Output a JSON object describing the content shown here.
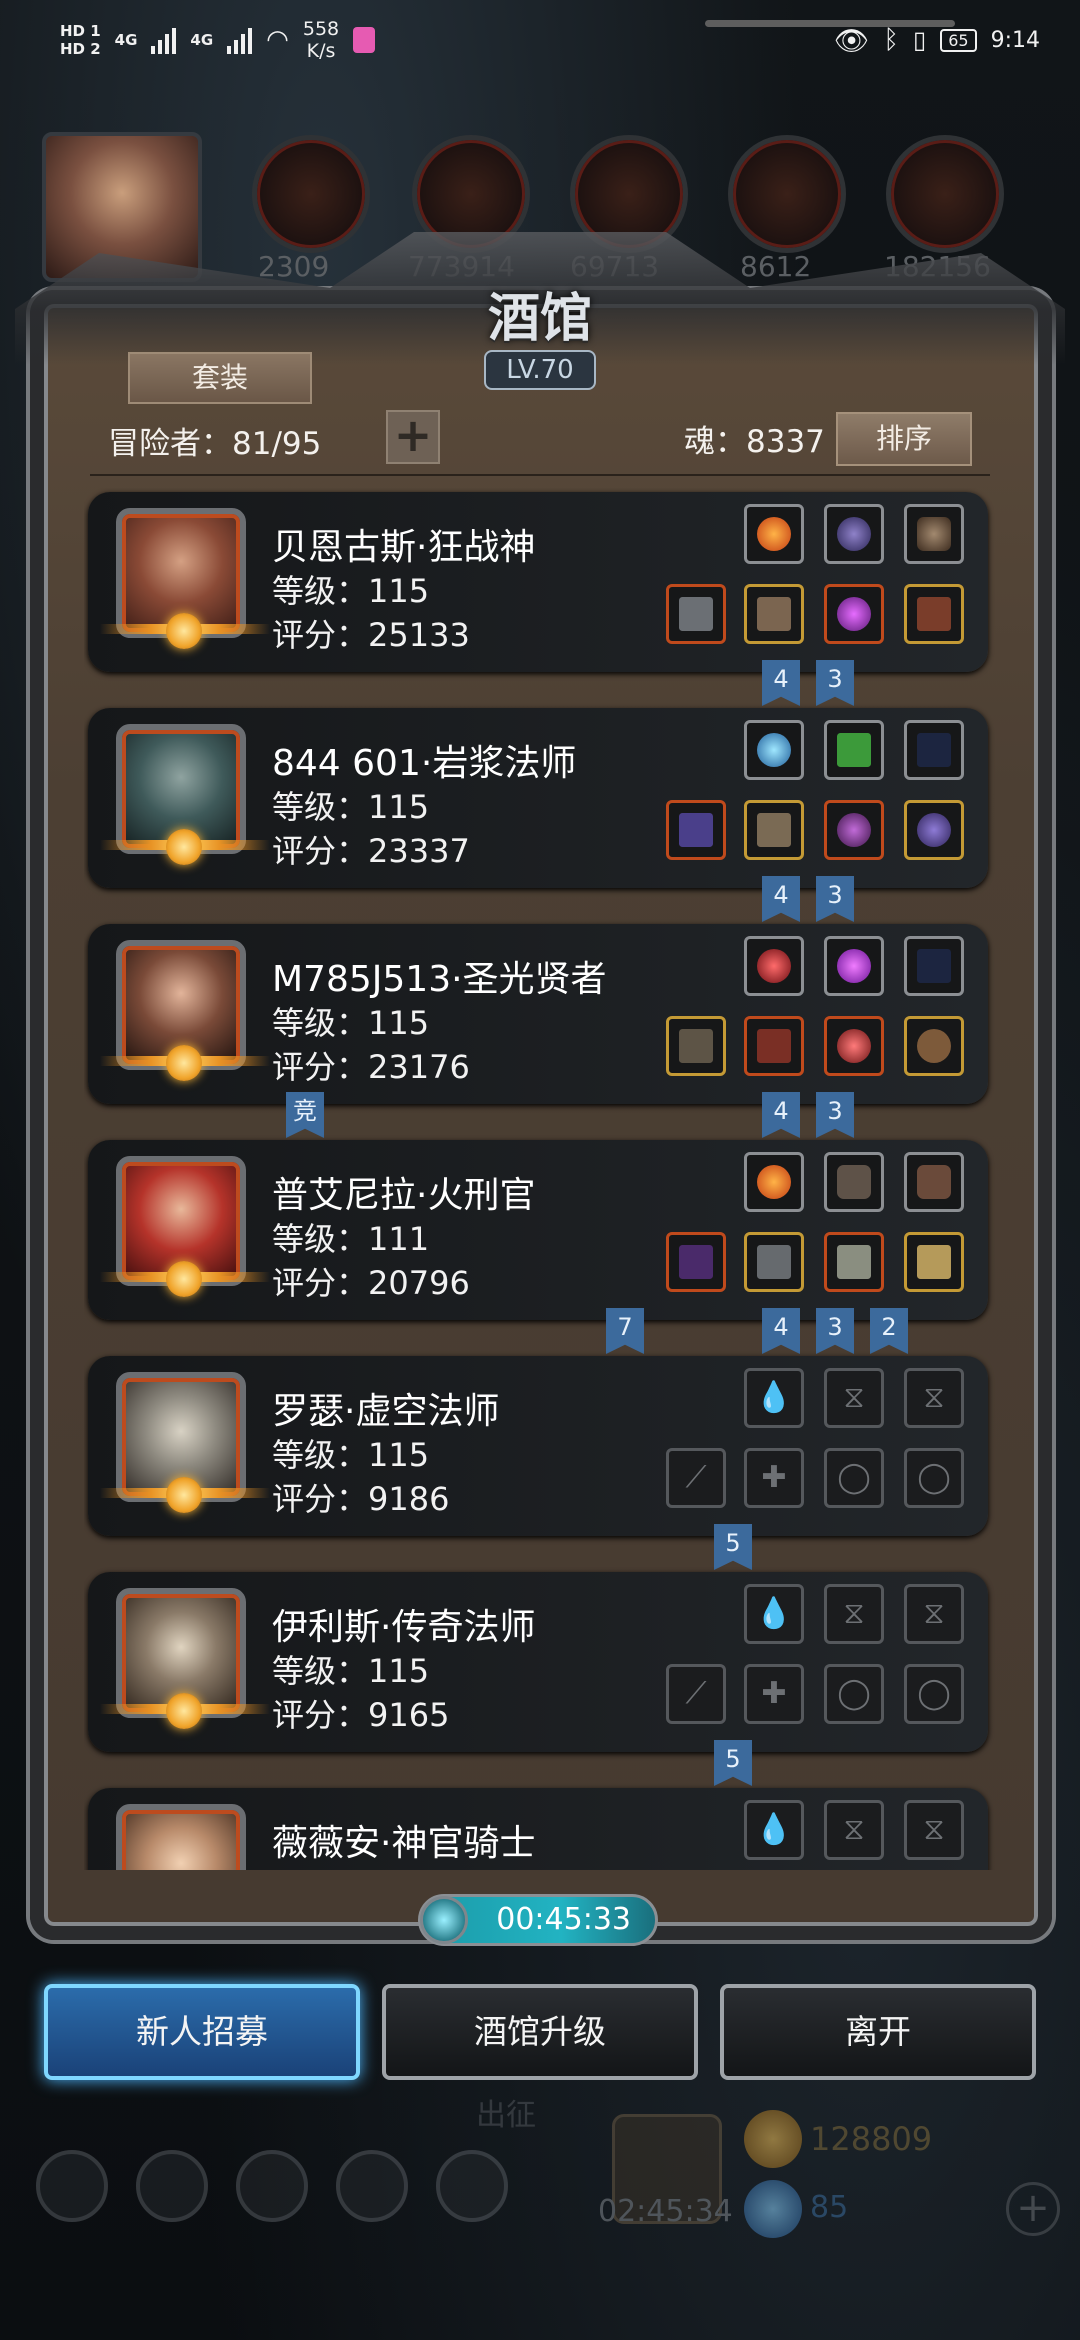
{
  "status_bar": {
    "hd1": "HD 1",
    "hd2": "HD 2",
    "net1": "4G",
    "net2": "4G",
    "speed_value": "558",
    "speed_unit": "K/s",
    "battery": "65",
    "time": "9:14"
  },
  "top_resources": [
    "2309",
    "773914",
    "69713",
    "8612",
    "182156"
  ],
  "tavern": {
    "title": "酒馆",
    "level": "LV.70",
    "outfit_button": "套装",
    "adventurer_count": "冒险者：81/95",
    "plus_label": "+",
    "soul": "魂：8337",
    "sort_button": "排序"
  },
  "heroes": [
    {
      "name": "贝恩古斯·狂战神",
      "level": "等级：115",
      "score": "评分：25133",
      "flags": [
        "4",
        "3"
      ],
      "colors": {
        "avatar": "#9a5a33"
      }
    },
    {
      "name": "844 601·岩浆法师",
      "level": "等级：115",
      "score": "评分：23337",
      "flags": [
        "4",
        "3"
      ],
      "colors": {
        "avatar": "#3f5a5a"
      }
    },
    {
      "name": "M785J513·圣光贤者",
      "level": "等级：115",
      "score": "评分：23176",
      "flags": [
        "竞",
        "4",
        "3"
      ],
      "colors": {
        "avatar": "#7a4a38"
      }
    },
    {
      "name": "普艾尼拉·火刑官",
      "level": "等级：111",
      "score": "评分：20796",
      "flags": [
        "7",
        "4",
        "3",
        "2"
      ],
      "colors": {
        "avatar": "#b5332a"
      }
    },
    {
      "name": "罗瑟·虚空法师",
      "level": "等级：115",
      "score": "评分：9186",
      "flags": [
        "5"
      ],
      "colors": {
        "avatar": "#8e8a80"
      }
    },
    {
      "name": "伊利斯·传奇法师",
      "level": "等级：115",
      "score": "评分：9165",
      "flags": [
        "5"
      ],
      "colors": {
        "avatar": "#8a7a68"
      }
    },
    {
      "name": "薇薇安·神官骑士",
      "level": "",
      "score": "",
      "flags": [],
      "colors": {
        "avatar": "#b88a6a"
      }
    }
  ],
  "timer": "00:45:33",
  "actions": {
    "recruit": "新人招募",
    "upgrade": "酒馆升级",
    "leave": "离开"
  },
  "dock": {
    "gold": "128809",
    "gem": "85",
    "chest_timer": "02:45:34",
    "expedition": "出征"
  },
  "accent_colors": {
    "panel": "#4c3f33",
    "flag": "#3c6a9c",
    "primary_button": "#2b6cab",
    "timer": "#22b3c2"
  }
}
